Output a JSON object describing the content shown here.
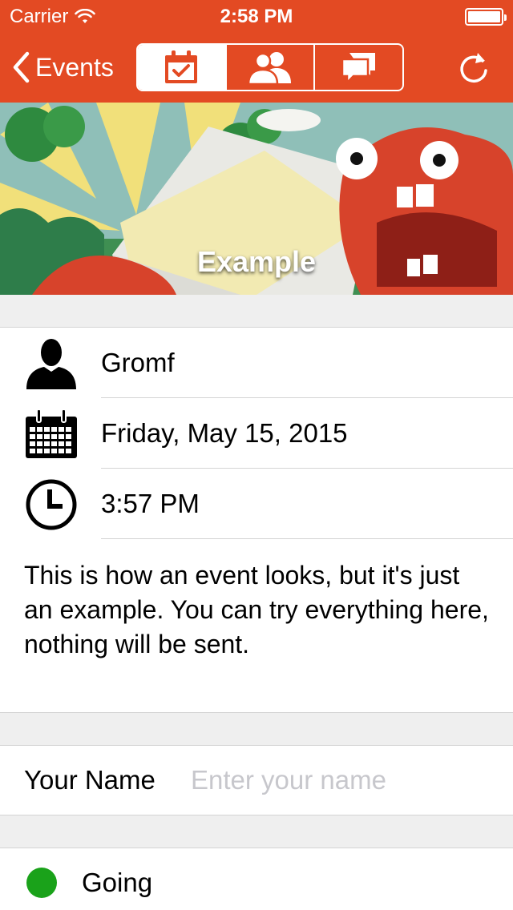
{
  "status_bar": {
    "carrier": "Carrier",
    "time": "2:58 PM"
  },
  "nav": {
    "back_label": "Events",
    "tabs": [
      {
        "icon": "calendar-check-icon",
        "active": true
      },
      {
        "icon": "people-icon",
        "active": false
      },
      {
        "icon": "chat-bubbles-icon",
        "active": false
      }
    ],
    "refresh_icon": "refresh-icon"
  },
  "event": {
    "title": "Example",
    "organizer": "Gromf",
    "date": "Friday, May 15, 2015",
    "time": "3:57 PM",
    "description": "This is how an event looks, but it's just an example. You can try everything here, nothing will be sent."
  },
  "name_field": {
    "label": "Your Name",
    "placeholder": "Enter your name",
    "value": ""
  },
  "rsvp": {
    "label": "Going",
    "color": "#1aa21a"
  },
  "colors": {
    "accent": "#e34a23",
    "separator": "#d4d4d4",
    "background": "#efefef"
  }
}
